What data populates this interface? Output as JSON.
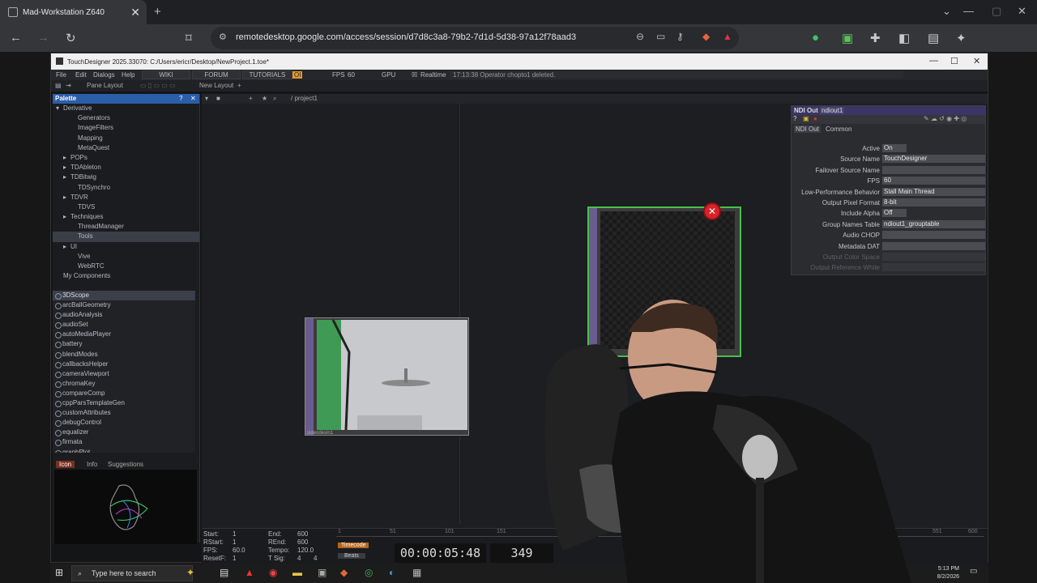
{
  "browser": {
    "tab_title": "Mad-Workstation Z640",
    "url": "remotedesktop.google.com/access/session/d7d8c3a8-79b2-7d1d-5d38-97a12f78aad3"
  },
  "td": {
    "window_title": "TouchDesigner 2025.33070: C:/Users/ericr/Desktop/NewProject.1.toe*",
    "menu": [
      "File",
      "Edit",
      "Dialogs",
      "Help"
    ],
    "tabs": [
      "WIKI",
      "FORUM",
      "TUTORIALS"
    ],
    "oi_badge": "OI",
    "fps_label": "FPS",
    "fps_value": "60",
    "gpu_label": "GPU",
    "realtime_label": "Realtime",
    "status_message": "17:13:38 Operator chopto1 deleted.",
    "pane_layout": "Pane Layout",
    "new_layout": "New Layout",
    "path": "/ project1"
  },
  "palette": {
    "title": "Palette",
    "tree": [
      {
        "label": "Derivative",
        "indent": 0,
        "arrow": "▾"
      },
      {
        "label": "Generators",
        "indent": 2,
        "arrow": ""
      },
      {
        "label": "ImageFilters",
        "indent": 2,
        "arrow": ""
      },
      {
        "label": "Mapping",
        "indent": 2,
        "arrow": ""
      },
      {
        "label": "MetaQuest",
        "indent": 2,
        "arrow": ""
      },
      {
        "label": "POPs",
        "indent": 1,
        "arrow": "▸"
      },
      {
        "label": "TDAbleton",
        "indent": 1,
        "arrow": "▸"
      },
      {
        "label": "TDBitwig",
        "indent": 1,
        "arrow": "▸"
      },
      {
        "label": "TDSynchro",
        "indent": 2,
        "arrow": ""
      },
      {
        "label": "TDVR",
        "indent": 1,
        "arrow": "▸"
      },
      {
        "label": "TDVS",
        "indent": 2,
        "arrow": ""
      },
      {
        "label": "Techniques",
        "indent": 1,
        "arrow": "▸"
      },
      {
        "label": "ThreadManager",
        "indent": 2,
        "arrow": ""
      },
      {
        "label": "Tools",
        "indent": 2,
        "arrow": "",
        "selected": true
      },
      {
        "label": "UI",
        "indent": 1,
        "arrow": "▸"
      },
      {
        "label": "Vive",
        "indent": 2,
        "arrow": ""
      },
      {
        "label": "WebRTC",
        "indent": 2,
        "arrow": ""
      },
      {
        "label": "My Components",
        "indent": 0,
        "arrow": ""
      }
    ],
    "components": [
      "3DScope",
      "arcBallGeometry",
      "audioAnalysis",
      "audioSet",
      "autoMediaPlayer",
      "battery",
      "blendModes",
      "callbacksHelper",
      "cameraViewport",
      "chromaKey",
      "compareComp",
      "cppParsTemplateGen",
      "customAttributes",
      "debugControl",
      "equalizer",
      "firmata",
      "graphPlot"
    ],
    "info_tabs": [
      "Icon",
      "Info",
      "Suggestions"
    ]
  },
  "nodes": {
    "video_name": "videodevin1",
    "ndi_name": "ndiout1"
  },
  "params": {
    "header_type": "NDI Out",
    "header_name": "ndiout1",
    "page_tabs": [
      "NDI Out",
      "Common"
    ],
    "rows": [
      {
        "label": "Active",
        "value": "On",
        "short": true
      },
      {
        "label": "Source Name",
        "value": "TouchDesigner"
      },
      {
        "label": "Failover Source Name",
        "value": ""
      },
      {
        "label": "FPS",
        "value": "60"
      },
      {
        "label": "Low-Performance Behavior",
        "value": "Stall Main Thread"
      },
      {
        "label": "Output Pixel Format",
        "value": "8-bit"
      },
      {
        "label": "Include Alpha",
        "value": "Off",
        "short": true
      },
      {
        "label": "Group Names Table",
        "value": "ndiout1_grouptable"
      },
      {
        "label": "Audio CHOP",
        "value": ""
      },
      {
        "label": "Metadata DAT",
        "value": ""
      },
      {
        "label": "Output Color Space",
        "value": "",
        "dim": true
      },
      {
        "label": "Output Reference White",
        "value": "",
        "dim": true
      }
    ]
  },
  "timeline": {
    "start_label": "Start:",
    "start": "1",
    "end_label": "End:",
    "end": "600",
    "rstart_label": "RStart:",
    "rstart": "1",
    "rend_label": "REnd:",
    "rend": "600",
    "fps_label": "FPS:",
    "fps": "60.0",
    "tempo_label": "Tempo:",
    "tempo": "120.0",
    "resetf_label": "ResetF:",
    "resetf": "1",
    "tsig_label": "T Sig:",
    "tsig_a": "4",
    "tsig_b": "4",
    "timecode_label": "Timecode",
    "beats_label": "Beats",
    "clock": "00:00:05:48",
    "frame": "349",
    "ruler": [
      "1",
      "51",
      "101",
      "151",
      "551",
      "600"
    ]
  },
  "taskbar": {
    "search_placeholder": "Type here to search",
    "time": "5:13 PM",
    "date": "8/2/2026"
  }
}
